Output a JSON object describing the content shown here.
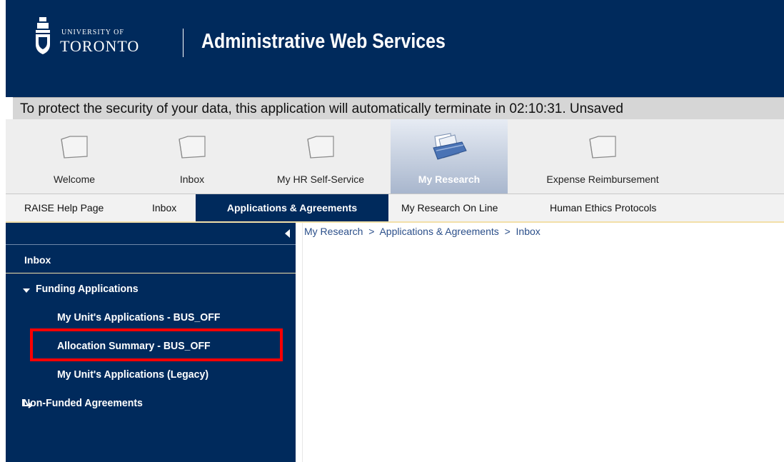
{
  "header": {
    "university_top": "UNIVERSITY OF",
    "university_name": "TORONTO",
    "site_title": "Administrative Web Services"
  },
  "banner": {
    "text": "To protect the security of your data, this application will automatically terminate in 02:10:31. Unsaved"
  },
  "tabs": [
    {
      "label": "Welcome",
      "icon": "folder-icon"
    },
    {
      "label": "Inbox",
      "icon": "folder-icon"
    },
    {
      "label": "My HR Self-Service",
      "icon": "folder-icon"
    },
    {
      "label": "My Research",
      "icon": "documents-icon",
      "active": true
    },
    {
      "label": "Expense Reimbursement",
      "icon": "folder-icon"
    }
  ],
  "subnav": [
    {
      "label": "RAISE Help Page"
    },
    {
      "label": "Inbox"
    },
    {
      "label": "Applications & Agreements",
      "active": true
    },
    {
      "label": "My Research On Line"
    },
    {
      "label": "Human Ethics Protocols"
    }
  ],
  "sidebar": {
    "inbox": "Inbox",
    "funding_applications": "Funding Applications",
    "children": [
      "My Unit's Applications - BUS_OFF",
      "Allocation Summary - BUS_OFF",
      "My Unit's Applications (Legacy)"
    ],
    "non_funded": "Non-Funded Agreements",
    "highlighted": "Allocation Summary - BUS_OFF"
  },
  "breadcrumb": {
    "items": [
      "My Research",
      "Applications & Agreements",
      "Inbox"
    ],
    "separator": ">"
  },
  "colors": {
    "navy": "#002a5c",
    "banner": "#d6d6d6",
    "highlight": "#ff0000",
    "link": "#2b4f8a"
  }
}
